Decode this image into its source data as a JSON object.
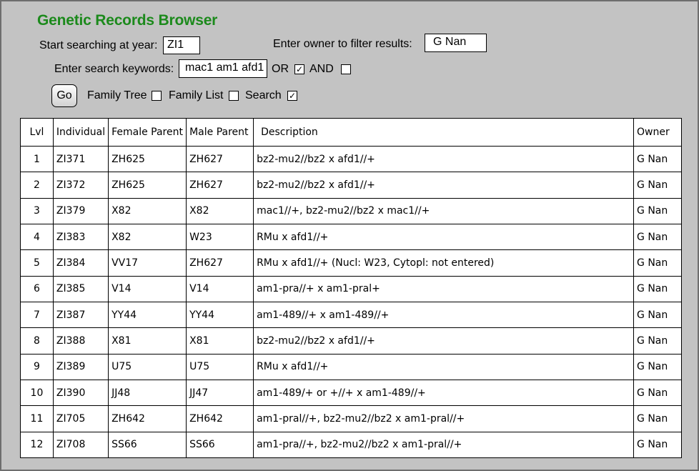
{
  "app": {
    "title": "Genetic Records Browser"
  },
  "search": {
    "year_label": "Start searching at year:",
    "year_value": "ZI1",
    "owner_label": "Enter owner to filter results:",
    "owner_value": "G Nan",
    "keywords_label": "Enter search keywords:",
    "keywords_value": "mac1 am1 afd1",
    "or_label": "OR",
    "or_checked": "✓",
    "and_label": "AND",
    "and_checked": ""
  },
  "actions": {
    "go_label": "Go",
    "family_tree_label": "Family Tree",
    "family_tree_checked": "",
    "family_list_label": "Family List",
    "family_list_checked": "",
    "search_label": "Search",
    "search_checked": "✓"
  },
  "table": {
    "headers": [
      "Lvl",
      "Individual",
      "Female Parent",
      "Male Parent",
      "Description",
      "Owner"
    ],
    "rows": [
      [
        "1",
        "ZI371",
        "ZH625",
        "ZH627",
        "bz2-mu2//bz2 x afd1//+",
        "G Nan"
      ],
      [
        "2",
        "ZI372",
        "ZH625",
        "ZH627",
        "bz2-mu2//bz2 x afd1//+",
        "G Nan"
      ],
      [
        "3",
        "ZI379",
        "X82",
        "X82",
        "mac1//+, bz2-mu2//bz2 x mac1//+",
        "G Nan"
      ],
      [
        "4",
        "ZI383",
        "X82",
        "W23",
        "RMu x afd1//+",
        "G Nan"
      ],
      [
        "5",
        "ZI384",
        "VV17",
        "ZH627",
        "RMu x afd1//+ (Nucl: W23, Cytopl: not entered)",
        "G Nan"
      ],
      [
        "6",
        "ZI385",
        "V14",
        "V14",
        "am1-pra//+ x am1-pral+",
        "G Nan"
      ],
      [
        "7",
        "ZI387",
        "YY44",
        "YY44",
        "am1-489//+ x am1-489//+",
        "G Nan"
      ],
      [
        "8",
        "ZI388",
        "X81",
        "X81",
        "bz2-mu2//bz2 x afd1//+",
        "G Nan"
      ],
      [
        "9",
        "ZI389",
        "U75",
        "U75",
        "RMu x afd1//+",
        "G Nan"
      ],
      [
        "10",
        "ZI390",
        "JJ48",
        "JJ47",
        "am1-489/+ or +//+ x am1-489//+",
        "G Nan"
      ],
      [
        "11",
        "ZI705",
        "ZH642",
        "ZH642",
        "am1-pral//+, bz2-mu2//bz2 x am1-pral//+",
        "G Nan"
      ],
      [
        "12",
        "ZI708",
        "SS66",
        "SS66",
        "am1-pra//+, bz2-mu2//bz2 x am1-pral//+",
        "G Nan"
      ]
    ]
  }
}
